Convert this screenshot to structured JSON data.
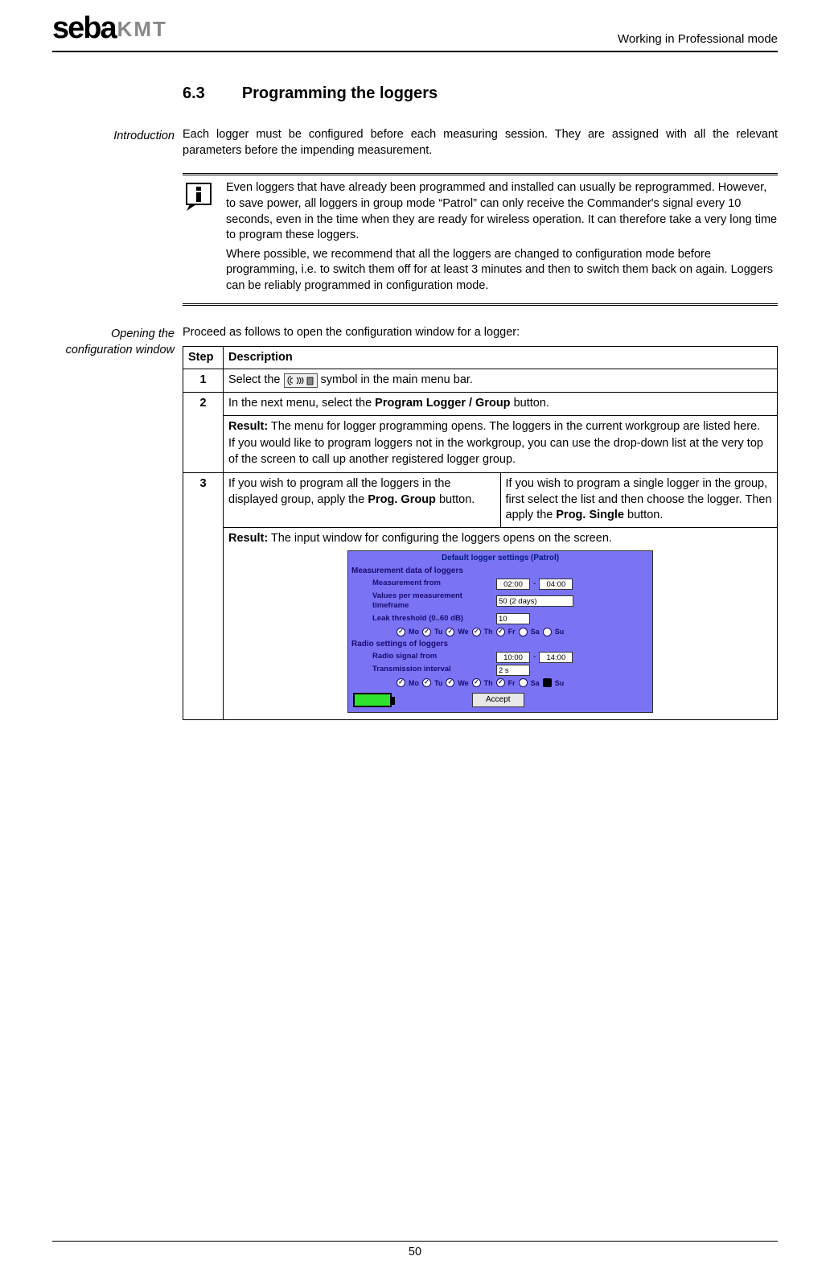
{
  "header": {
    "logo_seba": "seba",
    "logo_kmt": "KMT",
    "mode": "Working in Professional mode"
  },
  "section": {
    "number": "6.3",
    "title": "Programming the loggers"
  },
  "intro": {
    "label": "Introduction",
    "text": "Each logger must be configured before each measuring session. They are assigned with all the relevant parameters before the impending measurement."
  },
  "note": {
    "p1": "Even loggers that have already been programmed and installed can usually be reprogrammed. However, to save power, all loggers in group mode “Patrol” can only receive the Commander's signal every 10 seconds, even in the time when they are ready for wireless operation. It can therefore take a very long time to program these loggers.",
    "p2": "Where possible, we recommend that all the loggers are changed to configuration mode before programming, i.e. to switch them off for at least 3 minutes and then to switch them back on again. Loggers can be reliably programmed in configuration mode."
  },
  "opening": {
    "label": "Opening the configuration window",
    "lead": "Proceed as follows to open the configuration window for a logger:",
    "table": {
      "h_step": "Step",
      "h_desc": "Description",
      "r1": {
        "num": "1",
        "pre": "Select the ",
        "post": " symbol in the main menu bar."
      },
      "r2": {
        "num": "2",
        "line": "In the next menu, select the ",
        "bold": "Program Logger / Group",
        "after": " button.",
        "result_label": "Result:",
        "result_text": " The menu for logger programming opens. The loggers in the current workgroup are listed here.",
        "result_p2": "If you would like to program loggers not in the workgroup, you can use the drop-down list at the very top of the screen to call up another registered logger group."
      },
      "r3": {
        "num": "3",
        "left_pre": "If you wish to program all the loggers in the displayed group, apply the ",
        "left_bold": "Prog. Group",
        "left_after": " button.",
        "right_pre": "If you wish to program a single logger in the group, first select the list and then choose the logger. Then apply the ",
        "right_bold": "Prog. Single",
        "right_after": " button.",
        "result_label": "Result:",
        "result_text": " The input window for configuring the loggers opens on the screen."
      }
    }
  },
  "config_window": {
    "title": "Default logger settings (Patrol)",
    "sec1": "Measurement data of loggers",
    "meas_from_lbl": "Measurement from",
    "meas_from_a": "02:00",
    "meas_dash": "-",
    "meas_from_b": "04:00",
    "vals_lbl": "Values per measurement timeframe",
    "vals_val": "50 (2 days)",
    "leak_lbl": "Leak threshold (0..60 dB)",
    "leak_val": "10",
    "days": [
      "Mo",
      "Tu",
      "We",
      "Th",
      "Fr",
      "Sa",
      "Su"
    ],
    "sec2": "Radio settings of loggers",
    "radio_from_lbl": "Radio signal from",
    "radio_from_a": "10:00",
    "radio_from_b": "14:00",
    "tx_lbl": "Transmission interval",
    "tx_val": "2 s",
    "accept": "Accept"
  },
  "page_number": "50"
}
